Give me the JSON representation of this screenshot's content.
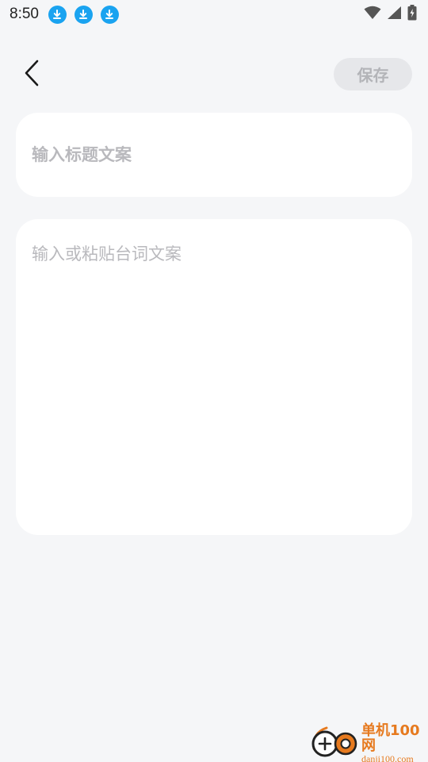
{
  "status_bar": {
    "time": "8:50",
    "download_icons": [
      "download-icon",
      "download-icon",
      "download-icon"
    ],
    "icons": [
      "wifi-icon",
      "cell-signal-icon",
      "battery-charging-icon"
    ],
    "accent": "#1aa3f0"
  },
  "header": {
    "back_icon": "chevron-left-icon",
    "save_label": "保存"
  },
  "title_field": {
    "value": "",
    "placeholder": "输入标题文案"
  },
  "content_field": {
    "value": "",
    "placeholder": "输入或粘贴台词文案"
  },
  "watermark": {
    "name": "单机100网",
    "url": "danji100.com",
    "color": "#e67a1f"
  }
}
